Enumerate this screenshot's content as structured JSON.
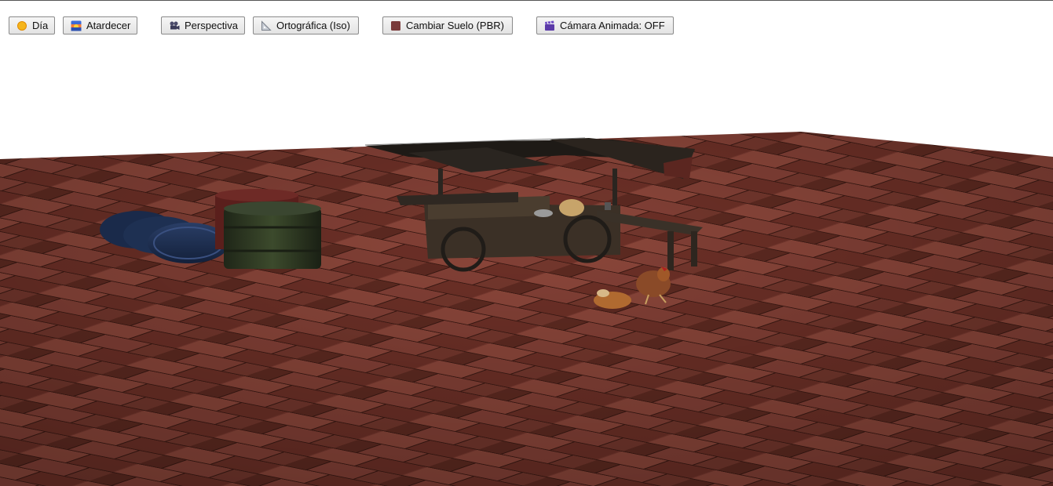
{
  "toolbar": {
    "day_label": "Día",
    "sunset_label": "Atardecer",
    "perspective_label": "Perspectiva",
    "ortho_label": "Ortográfica (Iso)",
    "floor_label": "Cambiar Suelo (PBR)",
    "anim_camera_label": "Cámara Animada: OFF"
  },
  "icons": {
    "day": "sun-icon",
    "sunset": "sunset-icon",
    "perspective": "movie-camera-icon",
    "ortho": "triangular-ruler-icon",
    "floor": "brown-square-icon",
    "anim_camera": "clapper-board-icon"
  },
  "colors": {
    "floor_base": "#7a3a30",
    "floor_dark": "#4a2119",
    "floor_light": "#9a5a4c",
    "sky": "#ffffff"
  }
}
